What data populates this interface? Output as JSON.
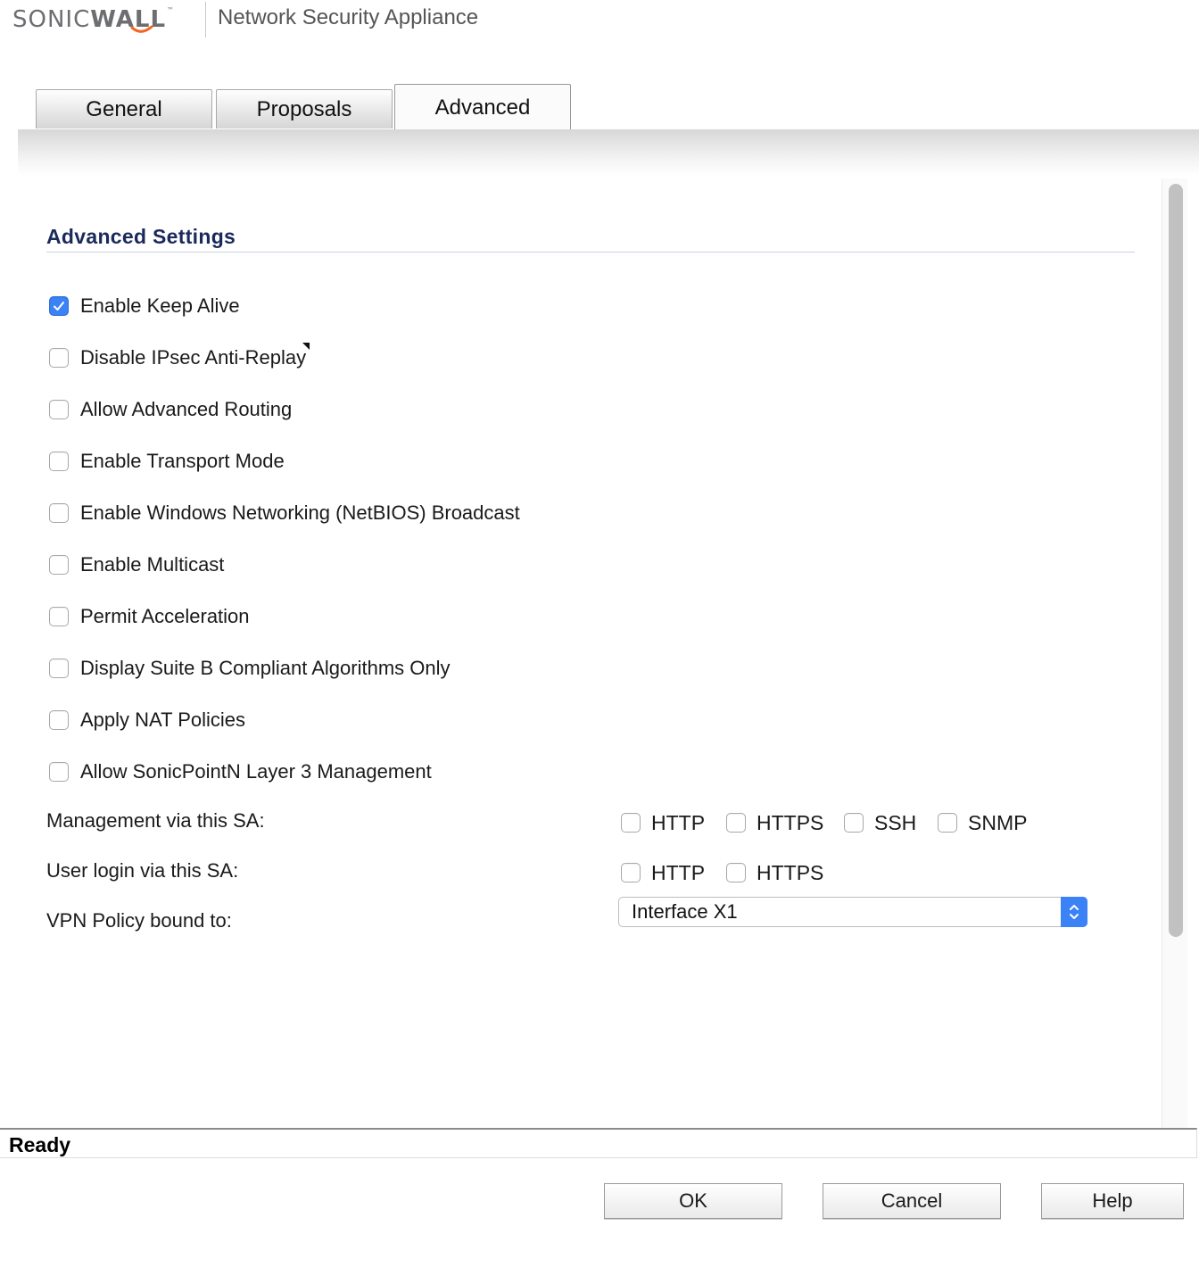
{
  "header": {
    "logo_text_light": "SONIC",
    "logo_text_bold": "WALL",
    "logo_tm": "™",
    "app_title": "Network Security Appliance"
  },
  "tabs": [
    {
      "label": "General",
      "active": false
    },
    {
      "label": "Proposals",
      "active": false
    },
    {
      "label": "Advanced",
      "active": true
    }
  ],
  "section": {
    "title": "Advanced Settings"
  },
  "options": [
    {
      "label": "Enable Keep Alive",
      "checked": true
    },
    {
      "label": "Disable IPsec Anti-Replay",
      "checked": false
    },
    {
      "label": "Allow Advanced Routing",
      "checked": false
    },
    {
      "label": "Enable Transport Mode",
      "checked": false
    },
    {
      "label": "Enable Windows Networking (NetBIOS) Broadcast",
      "checked": false
    },
    {
      "label": "Enable Multicast",
      "checked": false
    },
    {
      "label": "Permit Acceleration",
      "checked": false
    },
    {
      "label": "Display Suite B Compliant Algorithms Only",
      "checked": false
    },
    {
      "label": "Apply NAT Policies",
      "checked": false
    },
    {
      "label": "Allow SonicPointN Layer 3 Management",
      "checked": false
    }
  ],
  "management": {
    "label": "Management via this SA:",
    "protocols": [
      {
        "label": "HTTP",
        "checked": false
      },
      {
        "label": "HTTPS",
        "checked": false
      },
      {
        "label": "SSH",
        "checked": false
      },
      {
        "label": "SNMP",
        "checked": false
      }
    ]
  },
  "user_login": {
    "label": "User login via this SA:",
    "protocols": [
      {
        "label": "HTTP",
        "checked": false
      },
      {
        "label": "HTTPS",
        "checked": false
      }
    ]
  },
  "vpn_policy": {
    "label": "VPN Policy bound to:",
    "selected": "Interface X1"
  },
  "status": {
    "text": "Ready"
  },
  "buttons": {
    "ok": "OK",
    "cancel": "Cancel",
    "help": "Help"
  },
  "colors": {
    "accent": "#3b82f6",
    "section_title": "#1a2a5a",
    "logo_swoosh": "#f26522"
  }
}
